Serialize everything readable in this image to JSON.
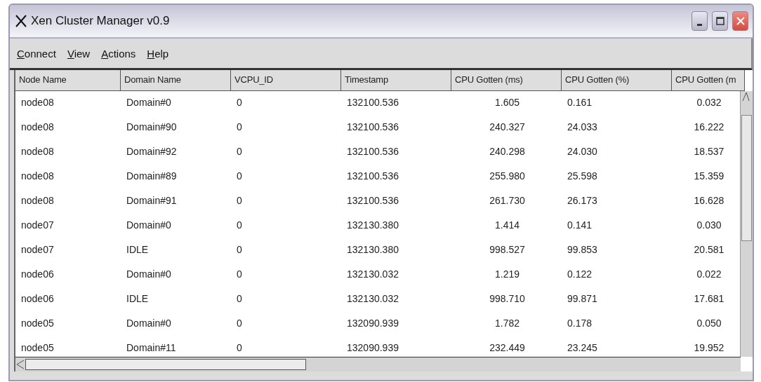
{
  "window": {
    "title": "Xen Cluster Manager v0.9"
  },
  "menu": [
    "Connect",
    "View",
    "Actions",
    "Help"
  ],
  "table": {
    "columns": [
      "Node Name",
      "Domain Name",
      "VCPU_ID",
      "Timestamp",
      "CPU Gotten (ms)",
      "CPU Gotten (%)",
      "CPU Gotten (m"
    ],
    "rows": [
      [
        "node08",
        "Domain#0",
        "0",
        "132100.536",
        "1.605",
        "0.161",
        "0.032"
      ],
      [
        "node08",
        "Domain#90",
        "0",
        "132100.536",
        "240.327",
        "24.033",
        "16.222"
      ],
      [
        "node08",
        "Domain#92",
        "0",
        "132100.536",
        "240.298",
        "24.030",
        "18.537"
      ],
      [
        "node08",
        "Domain#89",
        "0",
        "132100.536",
        "255.980",
        "25.598",
        "15.359"
      ],
      [
        "node08",
        "Domain#91",
        "0",
        "132100.536",
        "261.730",
        "26.173",
        "16.628"
      ],
      [
        "node07",
        "Domain#0",
        "0",
        "132130.380",
        "1.414",
        "0.141",
        "0.030"
      ],
      [
        "node07",
        "IDLE",
        "0",
        "132130.380",
        "998.527",
        "99.853",
        "20.581"
      ],
      [
        "node06",
        "Domain#0",
        "0",
        "132130.032",
        "1.219",
        "0.122",
        "0.022"
      ],
      [
        "node06",
        "IDLE",
        "0",
        "132130.032",
        "998.710",
        "99.871",
        "17.681"
      ],
      [
        "node05",
        "Domain#0",
        "0",
        "132090.939",
        "1.782",
        "0.178",
        "0.050"
      ],
      [
        "node05",
        "Domain#11",
        "0",
        "132090.939",
        "232.449",
        "23.245",
        "19.952"
      ]
    ]
  }
}
